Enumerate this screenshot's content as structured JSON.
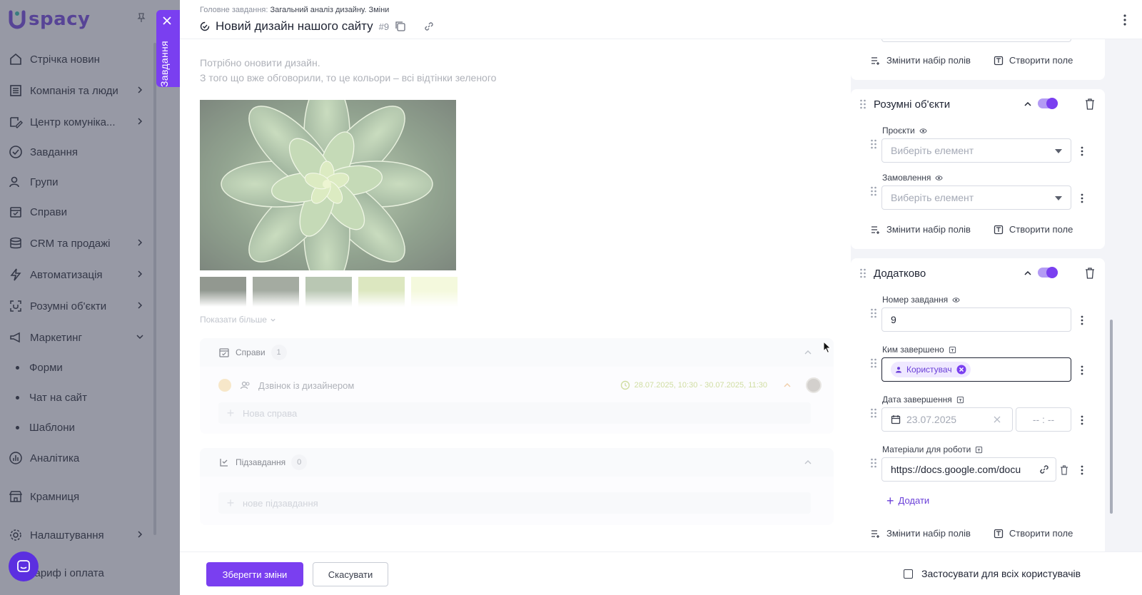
{
  "app": {
    "logo": "spacy"
  },
  "sidebar": {
    "items": [
      {
        "label": "Стрічка новин",
        "icon": "home-icon"
      },
      {
        "label": "Компанія та люди",
        "icon": "building-icon",
        "chevron": true
      },
      {
        "label": "Центр комуніка...",
        "icon": "chat-edit-icon",
        "chevron": true
      },
      {
        "label": "Завдання",
        "icon": "check-circle-icon"
      },
      {
        "label": "Групи",
        "icon": "users-icon"
      },
      {
        "label": "Справи",
        "icon": "calendar-check-icon"
      },
      {
        "label": "CRM та продажі",
        "icon": "database-icon",
        "chevron": true
      },
      {
        "label": "Автоматизація",
        "icon": "lightning-icon",
        "chevron": true
      },
      {
        "label": "Розумні об'єкти",
        "icon": "smart-object-icon",
        "chevron": true
      },
      {
        "label": "Маркетинг",
        "icon": "megaphone-icon",
        "chevron": true,
        "expanded": true
      },
      {
        "label": "Аналітика",
        "icon": "chart-icon"
      },
      {
        "label": "Крамниця",
        "icon": "store-icon"
      },
      {
        "label": "Налаштування",
        "icon": "gear-icon",
        "chevron": true
      },
      {
        "label": "Тариф і оплата",
        "icon": "wallet-icon"
      }
    ],
    "marketing_sub": [
      "Форми",
      "Чат на сайт",
      "Шаблони"
    ]
  },
  "side_tab": {
    "label": "Завдання"
  },
  "task": {
    "breadcrumb_label": "Головне завдання:",
    "breadcrumb_value": "Загальний аналіз дизайну. Зміни",
    "title": "Новий дизайн нашого сайту",
    "number": "#9",
    "description": [
      "Потрібно оновити дизайн.",
      "З того що вже обговорили, то це кольори – всі відтінки зеленого"
    ],
    "swatch_colors": [
      "#4f5a4d",
      "#6c7868",
      "#8fa585",
      "#c7d99a",
      "#eef5c8"
    ],
    "show_more": "Показати більше"
  },
  "activities": {
    "title": "Справи",
    "count": "1",
    "item_label": "Дзвінок із дизайнером",
    "item_time": "28.07.2025, 10:30 - 30.07.2025, 11:30",
    "new_placeholder": "Нова справа"
  },
  "subtasks": {
    "title": "Підзавдання",
    "count": "0",
    "new_placeholder": "нове підзавдання"
  },
  "right": {
    "change_fields": "Змінити набір полів",
    "create_field": "Створити поле",
    "smart": {
      "title": "Розумні об'єкти",
      "projects_label": "Проєкти",
      "orders_label": "Замовлення",
      "select_placeholder": "Виберіть елемент"
    },
    "extra": {
      "title": "Додатково",
      "task_number_label": "Номер завдання",
      "task_number_value": "9",
      "completed_by_label": "Ким завершено",
      "completed_by_chip": "Користувач",
      "completion_date_label": "Дата завершення",
      "completion_date_value": "23.07.2025",
      "completion_time_placeholder": "-- : --",
      "materials_label": "Матеріали для роботи",
      "materials_value": "https://docs.google.com/docu",
      "add_label": "Додати"
    }
  },
  "footer": {
    "save": "Зберегти зміни",
    "cancel": "Скасувати",
    "apply_all": "Застосувати для всіх користувачів"
  },
  "colors": {
    "accent": "#7a3ff0",
    "accent_light": "#efe8ff"
  }
}
